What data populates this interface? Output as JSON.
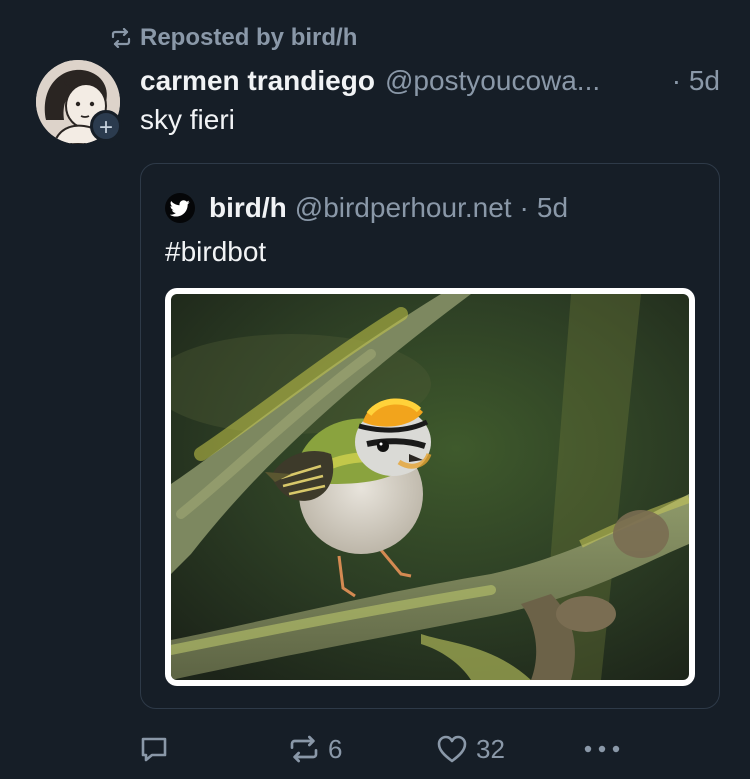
{
  "repost": {
    "label": "Reposted by bird/h",
    "icon": "repost-icon"
  },
  "post": {
    "display_name": "carmen trandiego",
    "handle": "@postyoucowa...",
    "time": "· 5d",
    "text": "sky fieri",
    "avatar_badge": "+"
  },
  "quote": {
    "display_name": "bird/h",
    "handle": "@birdperhour.net",
    "separator": "·",
    "time": "5d",
    "text": "#birdbot",
    "avatar_icon": "twitter-bird-icon",
    "image_subject": "small bird with orange crown perched on mossy branch"
  },
  "actions": {
    "reply_icon": "reply-icon",
    "repost_icon": "repost-icon",
    "repost_count": "6",
    "like_icon": "heart-icon",
    "like_count": "32",
    "more_icon": "more-icon"
  },
  "colors": {
    "background": "#161e27",
    "muted_text": "#8a98a8",
    "primary_text": "#f1f3f5",
    "border": "#2e3a48"
  }
}
